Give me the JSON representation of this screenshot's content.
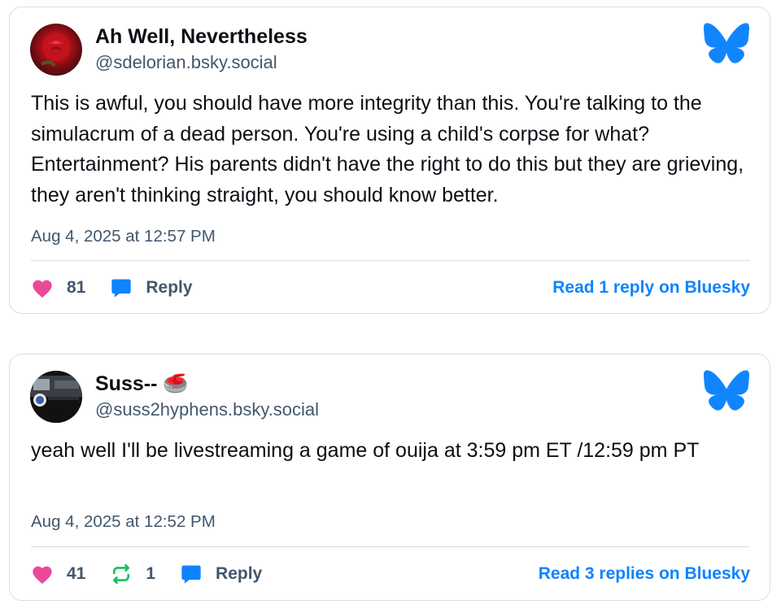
{
  "colors": {
    "like": "#ec4899",
    "repost": "#13c15a",
    "reply": "#1083fe",
    "link": "#1083fe",
    "muted": "#42576c",
    "bluesky_brand": "#1185fe"
  },
  "posts": [
    {
      "display_name": "Ah Well, Nevertheless",
      "handle": "@sdelorian.bsky.social",
      "avatar_icon": "rose-avatar",
      "text": "This is awful, you should have more integrity than this. You're talking to the simulacrum of a dead person. You're using a child's corpse for what? Entertainment? His parents didn't have the right to do this but they are grieving, they aren't thinking straight, you should know better.",
      "timestamp": "Aug 4, 2025 at 12:57 PM",
      "likes": "81",
      "reply_label": "Reply",
      "read_link": "Read 1 reply on Bluesky"
    },
    {
      "display_name": "Suss-- 🥌",
      "handle": "@suss2hyphens.bsky.social",
      "avatar_icon": "photo-avatar",
      "text": "yeah well I'll be livestreaming a game of ouija at 3:59 pm ET /12:59 pm PT",
      "timestamp": "Aug 4, 2025 at 12:52 PM",
      "likes": "41",
      "reposts": "1",
      "reply_label": "Reply",
      "read_link": "Read 3 replies on Bluesky"
    }
  ]
}
